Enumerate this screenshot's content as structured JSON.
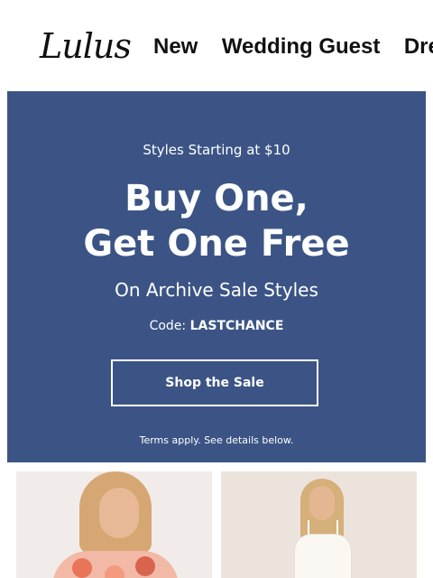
{
  "header": {
    "logo": "Lulus",
    "nav": [
      "New",
      "Wedding Guest",
      "Dresses"
    ]
  },
  "banner": {
    "eyebrow": "Styles Starting at $10",
    "headline_line1": "Buy One,",
    "headline_line2": "Get One Free",
    "subhead": "On Archive Sale Styles",
    "code_label": "Code:",
    "code_value": "LASTCHANCE",
    "cta": "Shop the Sale",
    "terms": "Terms apply. See details below.",
    "background_color": "#3b5485"
  }
}
